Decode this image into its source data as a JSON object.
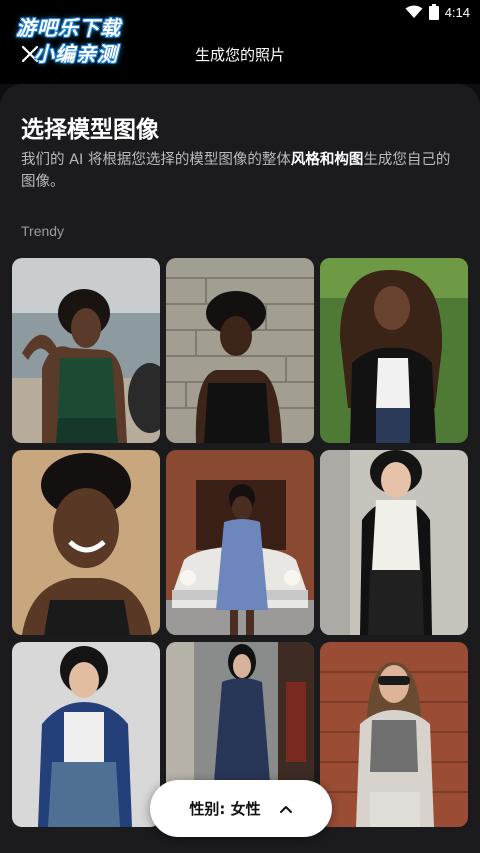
{
  "status_bar": {
    "time": "4:14",
    "icons": [
      "wifi-icon",
      "battery-icon"
    ]
  },
  "watermark": {
    "line1": "游吧乐下载",
    "line2": "小编亲测"
  },
  "header": {
    "title": "生成您的照片",
    "close_icon": "close-icon"
  },
  "main": {
    "heading": "选择模型图像",
    "description_part1": "我们的 AI 将根据您选择的模型图像的整体",
    "description_bold": "风格和构图",
    "description_part2": "生成您自己的图像。",
    "section_label": "Trendy",
    "photos": [
      {
        "description": "woman in green crop top at beach"
      },
      {
        "description": "woman in black top against stone wall"
      },
      {
        "description": "woman in leather jacket in front of hedge"
      },
      {
        "description": "smiling woman with short hair"
      },
      {
        "description": "woman in blue dress with white vintage car"
      },
      {
        "description": "woman in white turtleneck and leather pants"
      },
      {
        "description": "woman in blue jacket and jeans"
      },
      {
        "description": "woman in floral dress on street"
      },
      {
        "description": "woman in sunglasses against brick wall"
      }
    ]
  },
  "gender_selector": {
    "label": "性别: 女性",
    "icon": "chevron-up-icon"
  },
  "colors": {
    "background": "#0e0e10",
    "sheet": "#1b1b1e",
    "pill": "#ffffff"
  }
}
